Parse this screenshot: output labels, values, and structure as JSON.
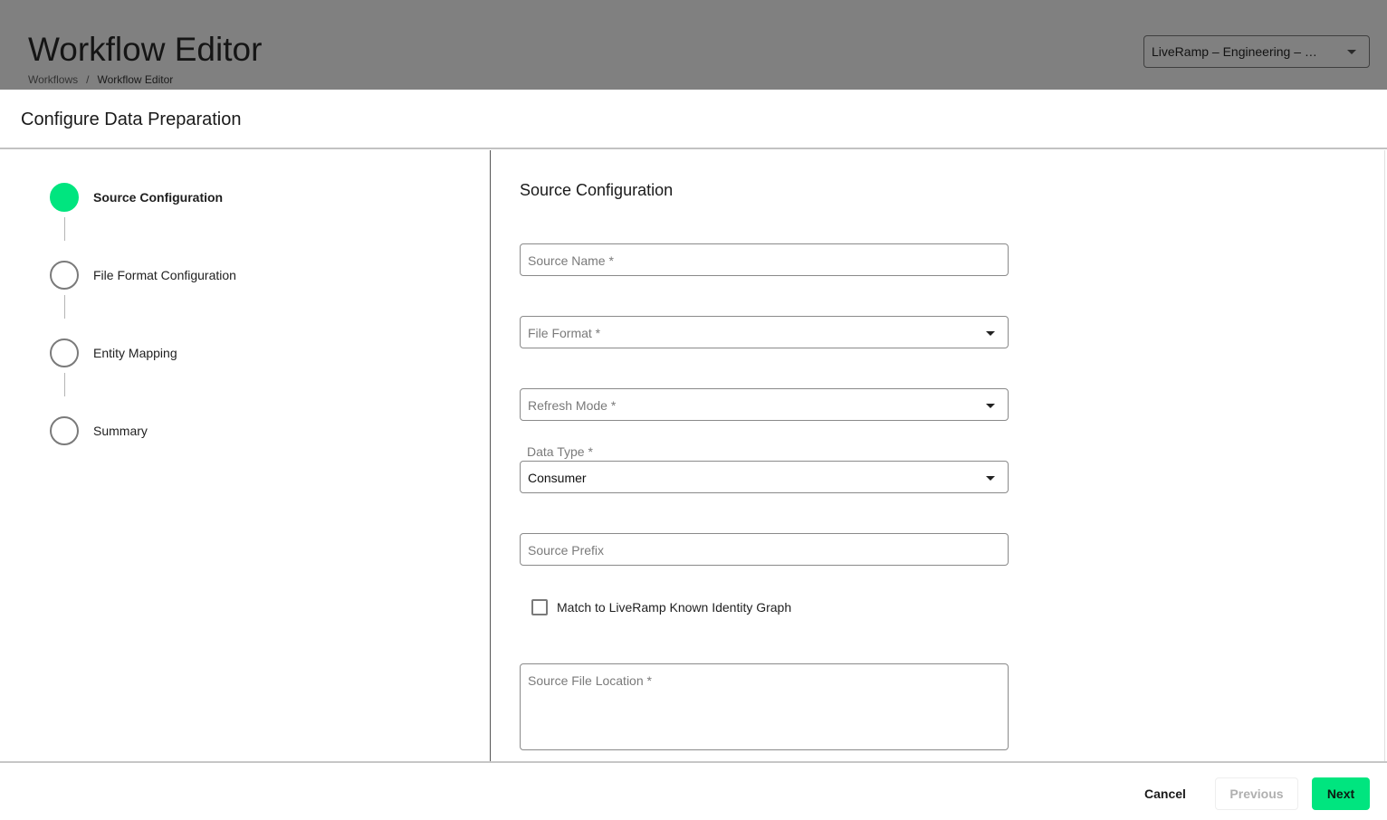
{
  "header": {
    "title": "Workflow Editor",
    "breadcrumb": [
      "Workflows",
      "Workflow Editor"
    ],
    "breadcrumb_separator": "/",
    "org_selector": {
      "value": "LiveRamp – Engineering – …",
      "icon": "chevron-down-icon"
    }
  },
  "modal": {
    "title": "Configure Data Preparation"
  },
  "stepper": {
    "steps": [
      {
        "label": "Source Configuration",
        "state": "active"
      },
      {
        "label": "File Format Configuration",
        "state": "pending"
      },
      {
        "label": "Entity Mapping",
        "state": "pending"
      },
      {
        "label": "Summary",
        "state": "pending"
      }
    ],
    "active_color": "#00e57f"
  },
  "form": {
    "section_title": "Source Configuration",
    "fields": {
      "source_name": {
        "placeholder": "Source Name *",
        "value": ""
      },
      "file_format": {
        "placeholder": "File Format *",
        "value": ""
      },
      "refresh_mode": {
        "placeholder": "Refresh Mode *",
        "value": ""
      },
      "data_type": {
        "label": "Data Type *",
        "value": "Consumer"
      },
      "source_prefix": {
        "placeholder": "Source Prefix",
        "value": ""
      },
      "source_file_location": {
        "placeholder": "Source File Location *",
        "value": ""
      }
    },
    "checkbox": {
      "label": "Match to LiveRamp Known Identity Graph",
      "checked": false
    }
  },
  "footer": {
    "cancel_label": "Cancel",
    "previous_label": "Previous",
    "next_label": "Next",
    "previous_disabled": true,
    "accent_color": "#00e57f"
  }
}
